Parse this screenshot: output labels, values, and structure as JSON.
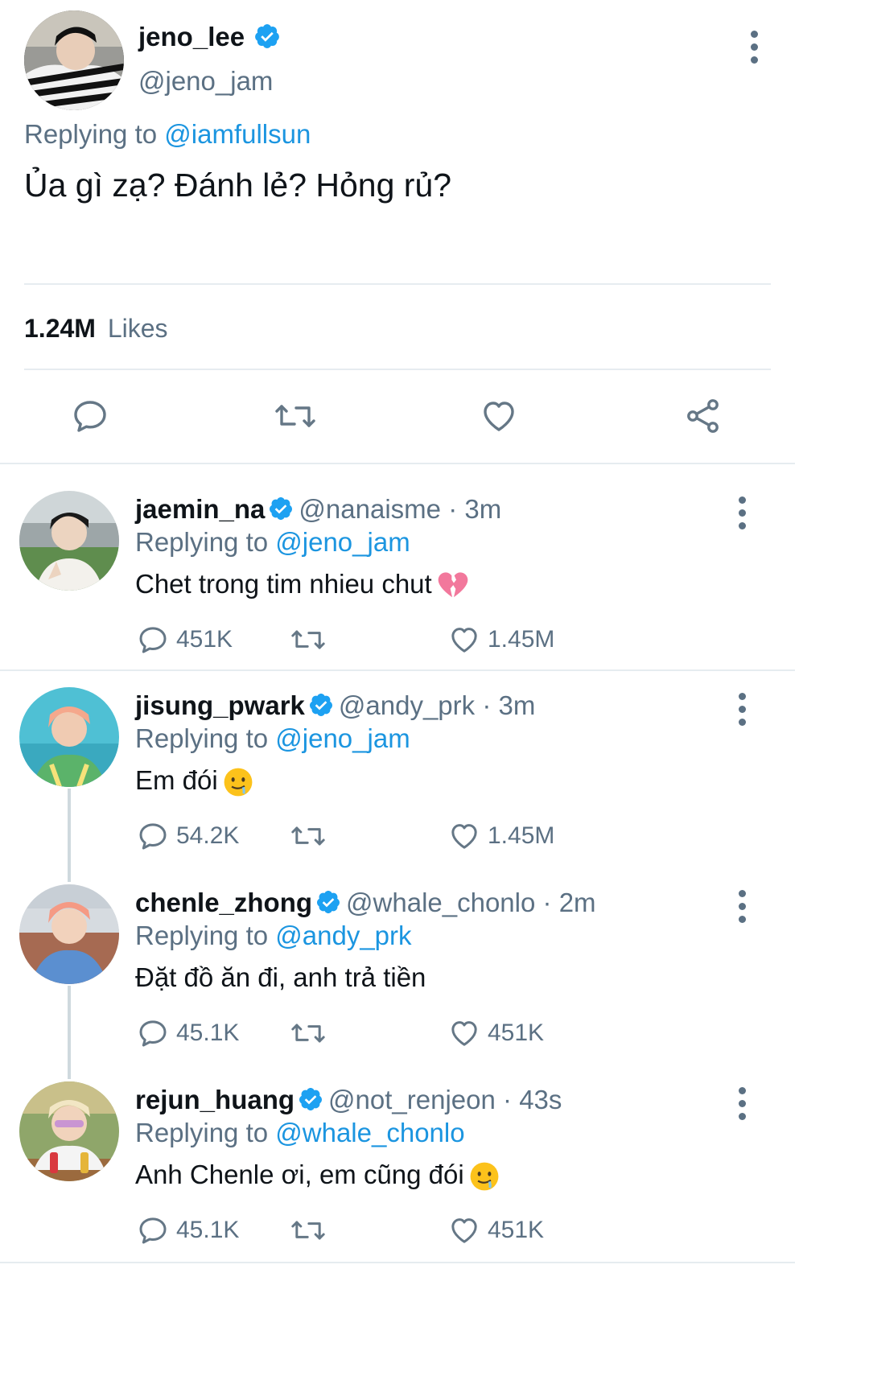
{
  "main_tweet": {
    "display_name": "jeno_lee",
    "handle": "@jeno_jam",
    "replying_prefix": "Replying to ",
    "replying_to": "@iamfullsun",
    "text": "Ủa gì zạ? Đánh lẻ? Hỏng rủ?",
    "likes_count": "1.24M",
    "likes_label": "Likes"
  },
  "replies": [
    {
      "display_name": "jaemin_na",
      "handle": "@nanaisme",
      "time": "· 3m",
      "replying_prefix": "Replying to ",
      "replying_to": "@jeno_jam",
      "text": "Chet trong tim nhieu chut",
      "emoji": "broken-heart-icon",
      "replies_count": "451K",
      "likes_count": "1.45M"
    },
    {
      "display_name": "jisung_pwark",
      "handle": "@andy_prk",
      "time": "· 3m",
      "replying_prefix": "Replying to ",
      "replying_to": "@jeno_jam",
      "text": "Em đói",
      "emoji": "drooling-face-icon",
      "replies_count": "54.2K",
      "likes_count": "1.45M"
    },
    {
      "display_name": "chenle_zhong",
      "handle": "@whale_chonlo",
      "time": "· 2m",
      "replying_prefix": "Replying to ",
      "replying_to": "@andy_prk",
      "text": "Đặt đồ ăn đi, anh trả tiền",
      "replies_count": "45.1K",
      "likes_count": "451K"
    },
    {
      "display_name": "rejun_huang",
      "handle": "@not_renjeon",
      "time": "· 43s",
      "replying_prefix": "Replying to ",
      "replying_to": "@whale_chonlo",
      "text": "Anh Chenle ơi, em cũng đói",
      "emoji": "drooling-face-icon",
      "replies_count": "45.1K",
      "likes_count": "451K"
    }
  ],
  "colors": {
    "link": "#1b95e0",
    "muted": "#5b7083",
    "verified": "#1da1f2",
    "divider": "#e6ecf0"
  }
}
